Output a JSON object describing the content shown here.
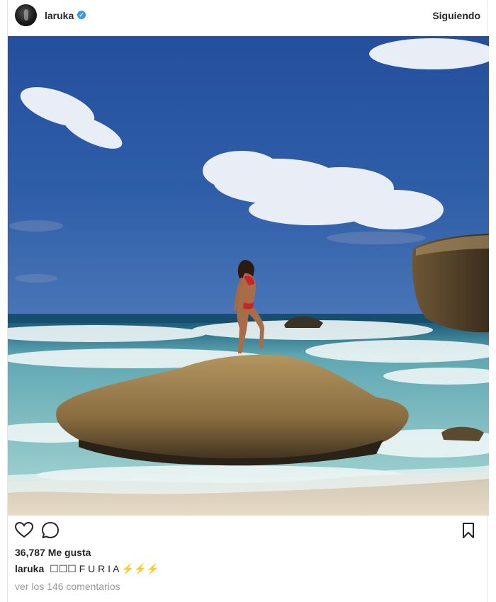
{
  "header": {
    "username": "laruka",
    "verified_mark": "✓",
    "follow_label": "Siguiendo"
  },
  "post": {
    "image_icon": "beach-photo",
    "likes": "36,787 Me gusta",
    "caption_user": "laruka",
    "caption_text": "☐☐☐ F U R I A ⚡⚡⚡",
    "comments_link": "ver los 146 comentarios"
  },
  "icons": {
    "like": "heart-icon",
    "comment": "comment-icon",
    "save": "bookmark-icon"
  },
  "colors": {
    "verified": "#3897f0",
    "sky": "#2d5aa6",
    "muted_text": "#999999"
  }
}
